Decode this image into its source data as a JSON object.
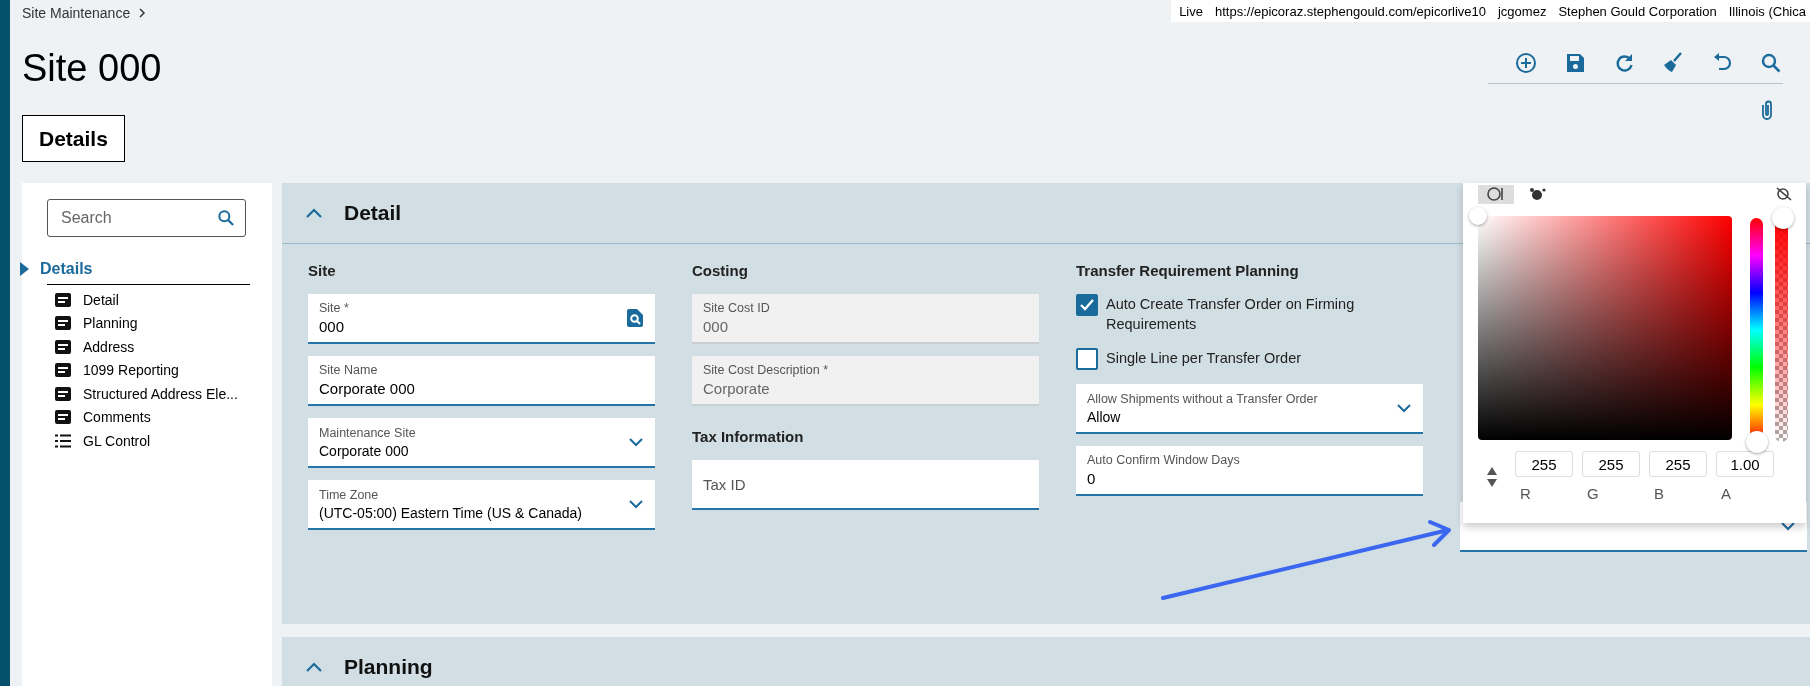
{
  "breadcrumb": {
    "label": "Site Maintenance"
  },
  "session_bar": [
    "Live",
    "https://epicoraz.stephengould.com/epicorlive10",
    "jcgomez",
    "Stephen Gould Corporation",
    "Illinois (Chica"
  ],
  "title": "Site 000",
  "toolbar": [
    {
      "kind": "add"
    },
    {
      "kind": "save"
    },
    {
      "kind": "refresh"
    },
    {
      "kind": "clear"
    },
    {
      "kind": "undo"
    },
    {
      "kind": "search"
    }
  ],
  "tabs": [
    {
      "label": "Details",
      "selected": true
    }
  ],
  "nav": {
    "search": {
      "placeholder": "Search"
    },
    "heading": "Details",
    "items": [
      {
        "label": "Detail",
        "kind": "form"
      },
      {
        "label": "Planning",
        "kind": "form"
      },
      {
        "label": "Address",
        "kind": "form"
      },
      {
        "label": "1099 Reporting",
        "kind": "form"
      },
      {
        "label": "Structured Address Ele...",
        "kind": "form"
      },
      {
        "label": "Comments",
        "kind": "form"
      },
      {
        "label": "GL Control",
        "kind": "list"
      }
    ]
  },
  "sections": [
    {
      "title": "Detail",
      "expanded": true,
      "columns": [
        [
          {
            "heading": "Site",
            "items": [
              {
                "kind": "lookup",
                "label": "Site *",
                "value": "000"
              },
              {
                "kind": "text",
                "label": "Site Name",
                "value": "Corporate 000"
              },
              {
                "kind": "dropdown",
                "label": "Maintenance Site",
                "value": "Corporate 000"
              },
              {
                "kind": "dropdown",
                "label": "Time Zone",
                "value": "(UTC-05:00) Eastern Time (US & Canada)"
              }
            ]
          }
        ],
        [
          {
            "heading": "Costing",
            "items": [
              {
                "kind": "readonly",
                "label": "Site Cost ID",
                "value": "000"
              },
              {
                "kind": "readonly",
                "label": "Site Cost Description *",
                "value": "Corporate"
              }
            ]
          },
          {
            "heading": "Tax Information",
            "items": [
              {
                "kind": "text",
                "placeholder": "Tax ID"
              }
            ]
          }
        ],
        [
          {
            "heading": "Transfer Requirement Planning",
            "items": [
              {
                "kind": "checkbox",
                "label": "Auto Create Transfer Order on Firming Requirements",
                "checked": true
              },
              {
                "kind": "checkbox",
                "label": "Single Line per Transfer Order",
                "checked": false
              },
              {
                "kind": "dropdown",
                "label": "Allow Shipments without a Transfer Order",
                "value": "Allow"
              },
              {
                "kind": "text",
                "label": "Auto Confirm Window Days",
                "value": "0"
              }
            ]
          }
        ],
        [
          {
            "items": [
              {
                "kind": "dropdown"
              }
            ]
          }
        ]
      ]
    },
    {
      "title": "Planning",
      "expanded": true
    }
  ],
  "color_picker": {
    "tabs": [
      {
        "selected": true
      },
      {
        "selected": false
      }
    ],
    "hue": {
      "level": 0
    },
    "alpha": {
      "level": 1
    },
    "channels": [
      {
        "label": "R",
        "value": "255"
      },
      {
        "label": "G",
        "value": "255"
      },
      {
        "label": "B",
        "value": "255"
      },
      {
        "label": "A",
        "value": "1.00"
      }
    ]
  }
}
